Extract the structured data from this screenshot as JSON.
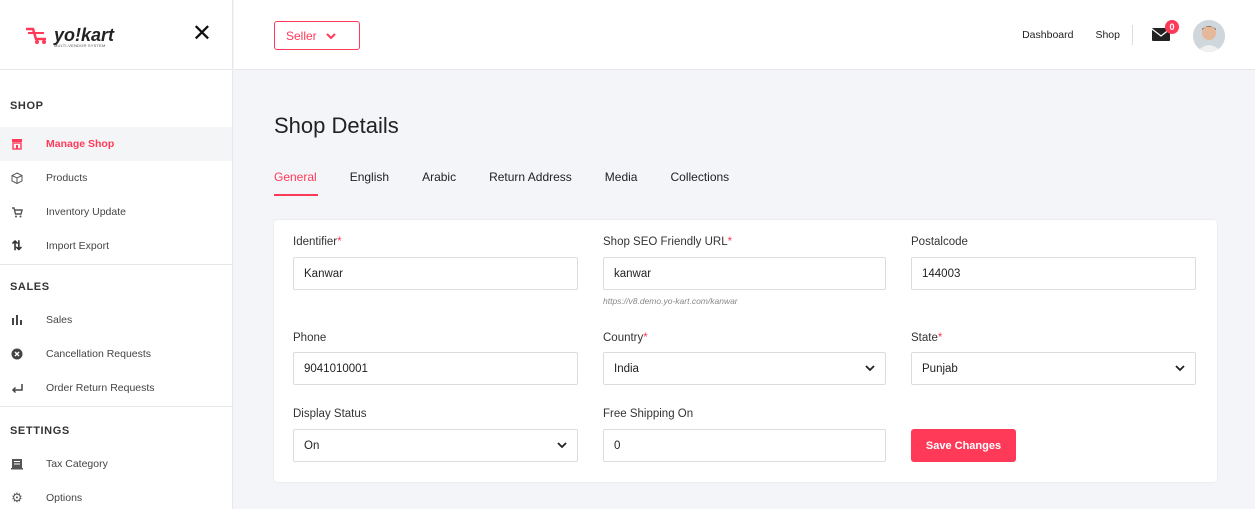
{
  "brand": {
    "name": "yo!kart",
    "tagline": "MULTI-VENDOR SYSTEM"
  },
  "sidebar": {
    "sections": [
      {
        "title": "SHOP",
        "items": [
          {
            "label": "Manage Shop",
            "icon": "store-icon",
            "active": true
          },
          {
            "label": "Products",
            "icon": "box-icon"
          },
          {
            "label": "Inventory Update",
            "icon": "cart-icon"
          },
          {
            "label": "Import Export",
            "icon": "arrows-updown-icon"
          }
        ]
      },
      {
        "title": "SALES",
        "items": [
          {
            "label": "Sales",
            "icon": "bar-chart-icon"
          },
          {
            "label": "Cancellation Requests",
            "icon": "cancel-circle-icon"
          },
          {
            "label": "Order Return Requests",
            "icon": "return-icon"
          }
        ]
      },
      {
        "title": "SETTINGS",
        "items": [
          {
            "label": "Tax Category",
            "icon": "tax-icon"
          },
          {
            "label": "Options",
            "icon": "gear-icon"
          }
        ]
      }
    ]
  },
  "topbar": {
    "seller_label": "Seller",
    "links": {
      "dashboard": "Dashboard",
      "shop": "Shop"
    },
    "notification_count": "0"
  },
  "page": {
    "title": "Shop Details",
    "tabs": [
      "General",
      "English",
      "Arabic",
      "Return Address",
      "Media",
      "Collections"
    ],
    "active_tab": "General"
  },
  "form": {
    "identifier": {
      "label": "Identifier",
      "value": "Kanwar"
    },
    "seo_url": {
      "label": "Shop SEO Friendly URL",
      "value": "kanwar",
      "hint": "https://v8.demo.yo-kart.com/kanwar"
    },
    "postalcode": {
      "label": "Postalcode",
      "value": "144003"
    },
    "phone": {
      "label": "Phone",
      "value": "9041010001"
    },
    "country": {
      "label": "Country",
      "value": "India"
    },
    "state": {
      "label": "State",
      "value": "Punjab"
    },
    "display_status": {
      "label": "Display Status",
      "value": "On"
    },
    "free_shipping": {
      "label": "Free Shipping On",
      "value": "0"
    },
    "required_mark": "*",
    "save_label": "Save Changes"
  },
  "colors": {
    "accent": "#ff3a59",
    "background": "#f4f5f8"
  }
}
